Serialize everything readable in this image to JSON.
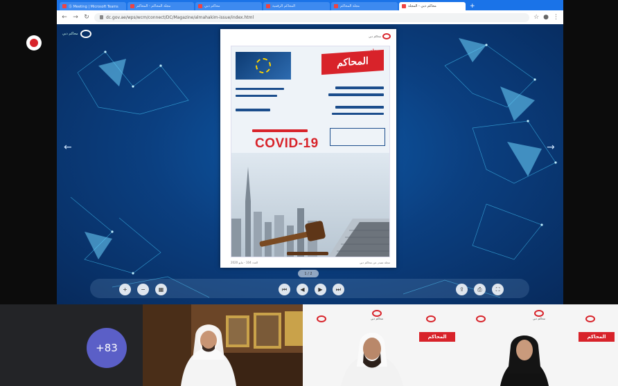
{
  "meeting": {
    "record_icon": "record-icon",
    "participant_overflow": "+83"
  },
  "browser": {
    "tabs": [
      {
        "label": "Ⓢ Meeting | Microsoft Teams",
        "active": false
      },
      {
        "label": "مجلة المحاكم - المحاكم",
        "active": false
      },
      {
        "label": "محاكم دبي",
        "active": false
      },
      {
        "label": "المحاكم الرقمية",
        "active": false
      },
      {
        "label": "مجلة المحاكم",
        "active": false
      },
      {
        "label": "محاكم دبي - المجلة",
        "active": true
      }
    ],
    "new_tab_label": "+",
    "url": "dc.gov.ae/wps/wcm/connect/DC/Magazine/almahakim-issue/index.html"
  },
  "viewer": {
    "site_logo_text": "محاكم دبي",
    "page_indicator": "1 / 2",
    "page_logo_text": "محاكم دبي",
    "magazine": {
      "small_title": "مجلة",
      "masthead": "المحاكم",
      "headline": "COVID-19",
      "footer_left": "العدد 104 - مايو 2020",
      "footer_right": "مجلة تصدر عن محاكم دبي"
    }
  },
  "controls": {
    "left": [
      {
        "name": "zoom-in-button",
        "glyph": "+"
      },
      {
        "name": "zoom-out-button",
        "glyph": "−"
      },
      {
        "name": "thumbnails-button",
        "glyph": "▦"
      }
    ],
    "center": [
      {
        "name": "first-page-button",
        "glyph": "⏮"
      },
      {
        "name": "prev-page-button",
        "glyph": "◀"
      },
      {
        "name": "next-page-button",
        "glyph": "▶"
      },
      {
        "name": "last-page-button",
        "glyph": "⏭"
      }
    ],
    "right": [
      {
        "name": "share-button",
        "glyph": "⇪"
      },
      {
        "name": "print-button",
        "glyph": "⎙"
      },
      {
        "name": "fullscreen-button",
        "glyph": "⛶"
      }
    ]
  },
  "studio": {
    "brand_text": "محاكم دبي",
    "label": "المحاكم"
  },
  "colors": {
    "accent_red": "#d8232a",
    "teams_purple": "#5b5fc7",
    "chrome_blue": "#1a73e8"
  }
}
